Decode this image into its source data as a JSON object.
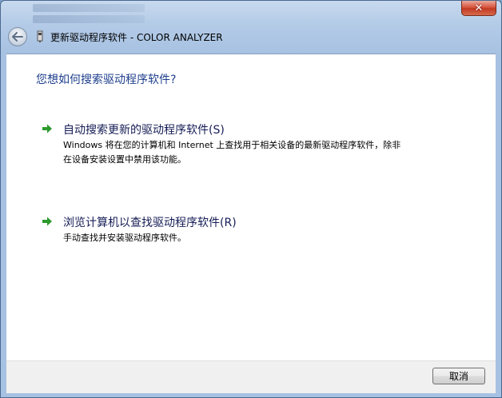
{
  "window": {
    "title": "更新驱动程序软件 - COLOR ANALYZER",
    "close_label": "✕"
  },
  "heading": "您想如何搜索驱动程序软件?",
  "options": [
    {
      "title": "自动搜索更新的驱动程序软件(S)",
      "description": "Windows 将在您的计算机和 Internet 上查找用于相关设备的最新驱动程序软件，除非在设备安装设置中禁用该功能。",
      "icon": "green-arrow-icon"
    },
    {
      "title": "浏览计算机以查找驱动程序软件(R)",
      "description": "手动查找并安装驱动程序软件。",
      "icon": "green-arrow-icon"
    }
  ],
  "footer": {
    "cancel_label": "取消"
  },
  "colors": {
    "heading": "#1e3f8c",
    "option_title": "#151c55",
    "arrow": "#2c9a2c",
    "close": "#c13a22"
  }
}
